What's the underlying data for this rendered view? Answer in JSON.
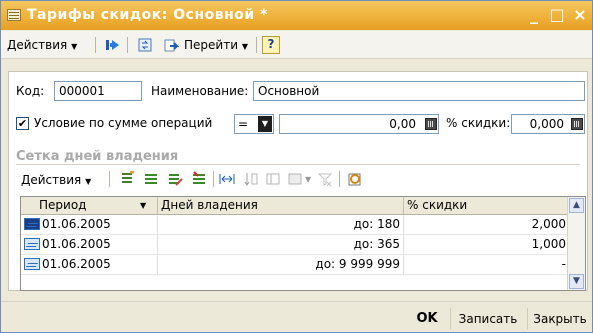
{
  "window": {
    "title": "Тарифы скидок: Основной *",
    "controls": {
      "minimize": "_",
      "maximize": "□",
      "close": "×"
    }
  },
  "toolbar": {
    "actions_label": "Действия",
    "goto_label": "Перейти",
    "help_label": "?"
  },
  "form": {
    "code_label": "Код:",
    "code_value": "000001",
    "name_label": "Наименование:",
    "name_value": "Основной",
    "condition_label": "Условие по сумме операций",
    "condition_checked": "✔",
    "operator_value": "=",
    "amount_value": "0,00",
    "discount_label": "% скидки:",
    "discount_value": "0,000"
  },
  "section": {
    "title": "Сетка дней владения",
    "actions_label": "Действия"
  },
  "grid": {
    "columns": [
      "Период",
      "Дней владения",
      "% скидки"
    ],
    "rows": [
      {
        "period": "01.06.2005",
        "days": "до: 180",
        "discount": "2,000"
      },
      {
        "period": "01.06.2005",
        "days": "до: 365",
        "discount": "1,000"
      },
      {
        "period": "01.06.2005",
        "days": "до: 9 999 999",
        "discount": "-"
      }
    ]
  },
  "footer": {
    "ok_label": "OK",
    "save_label": "Записать",
    "close_label": "Закрыть"
  }
}
